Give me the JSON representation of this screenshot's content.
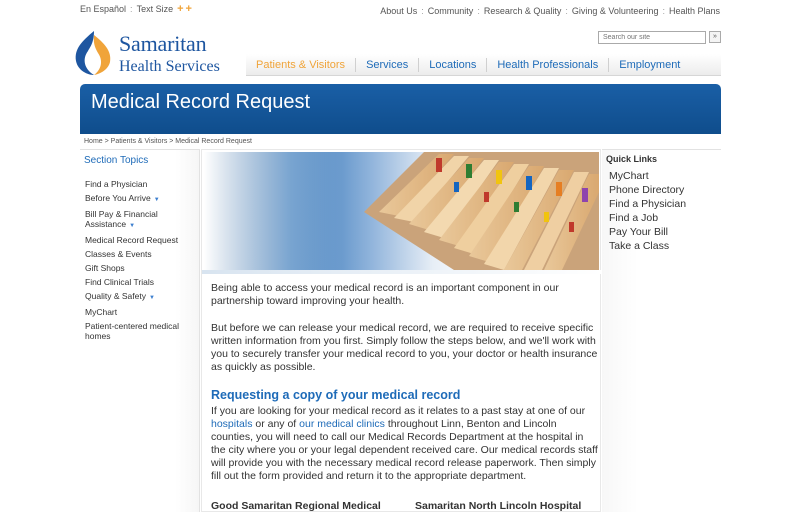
{
  "utility": {
    "espanol": "En Español",
    "text_size": "Text Size",
    "plus_small": "+",
    "plus_large": "+",
    "links": [
      "About Us",
      "Community",
      "Research & Quality",
      "Giving & Volunteering",
      "Health Plans"
    ]
  },
  "logo": {
    "line1": "Samaritan",
    "line2": "Health Services"
  },
  "search": {
    "placeholder": "Search our site",
    "button": "»"
  },
  "nav": [
    {
      "label": "Patients & Visitors",
      "active": true
    },
    {
      "label": "Services"
    },
    {
      "label": "Locations"
    },
    {
      "label": "Health Professionals"
    },
    {
      "label": "Employment"
    }
  ],
  "page_title": "Medical Record Request",
  "breadcrumb": "Home > Patients & Visitors > Medical Record Request",
  "section_topics": {
    "title": "Section Topics",
    "items": [
      {
        "label": "Find a Physician"
      },
      {
        "label": "Before You Arrive",
        "caret": "▼"
      },
      {
        "label": "Bill Pay & Financial Assistance",
        "caret": "▼"
      },
      {
        "label": "Medical Record Request"
      },
      {
        "label": "Classes & Events"
      },
      {
        "label": "Gift Shops"
      },
      {
        "label": "Find Clinical Trials"
      },
      {
        "label": "Quality & Safety",
        "caret": "▼"
      },
      {
        "label": "MyChart"
      },
      {
        "label": "Patient-centered medical homes"
      }
    ]
  },
  "content": {
    "p1": "Being able to access your medical record is an important component in our partnership toward improving your health.",
    "p2": "But before we can release your medical record, we are required to receive specific written information from you first. Simply follow the steps below, and we'll work with you to securely transfer your medical record to you, your doctor or health insurance as quickly as possible.",
    "heading": "Requesting a copy of your medical record",
    "p3_a": "If you are looking for your medical record as it relates to a past stay at one of our ",
    "p3_link1": "hospitals",
    "p3_b": " or any of ",
    "p3_link2": "our medical clinics",
    "p3_c": " throughout Linn, Benton and Lincoln counties, you will need to call our Medical Records Department at the hospital in the city where you or your legal dependent received care. Our medical records staff will provide you with the necessary medical record release paperwork. Then simply fill out the form provided and return it to the appropriate department.",
    "hosp1": "Good Samaritan Regional Medical",
    "hosp2": "Samaritan North Lincoln Hospital"
  },
  "quick_links": {
    "title": "Quick Links",
    "items": [
      "MyChart",
      "Phone Directory",
      "Find a Physician",
      "Find a Job",
      "Pay Your Bill",
      "Take a Class"
    ]
  },
  "colors": {
    "brand_blue": "#1e56a0",
    "link_blue": "#1e6bb8",
    "accent_orange": "#f0a43a"
  }
}
